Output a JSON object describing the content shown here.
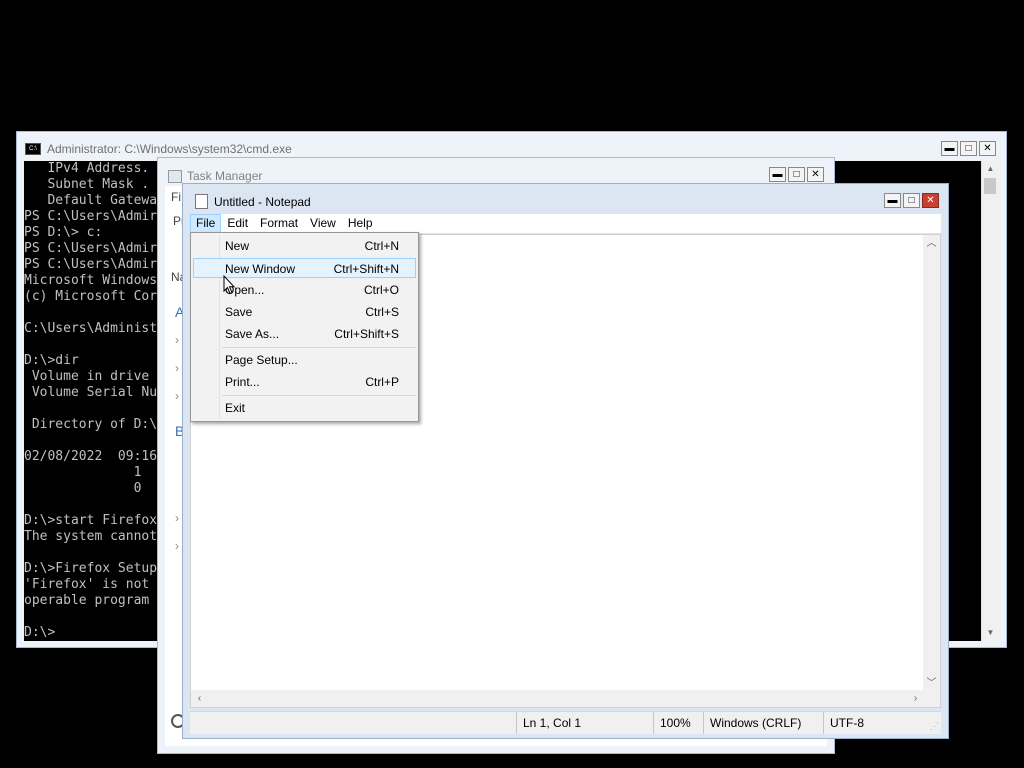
{
  "cmd": {
    "title": "Administrator: C:\\Windows\\system32\\cmd.exe",
    "icon": "cmd-icon",
    "lines": [
      "   IPv4 Address. ",
      "   Subnet Mask . ",
      "   Default Gatewa",
      "PS C:\\Users\\Admir",
      "PS D:\\> c:",
      "PS C:\\Users\\Admir",
      "PS C:\\Users\\Admir",
      "Microsoft Windows",
      "(c) Microsoft Cor",
      "",
      "C:\\Users\\Administ",
      "",
      "D:\\>dir",
      " Volume in drive ",
      " Volume Serial Nu",
      "",
      " Directory of D:\\",
      "",
      "02/08/2022  09:16",
      "              1",
      "              0",
      "",
      "D:\\>start Firefox",
      "The system cannot",
      "",
      "D:\\>Firefox Setup",
      "'Firefox' is not ",
      "operable program ",
      "",
      "D:\\>"
    ]
  },
  "task_manager": {
    "title": "Task Manager",
    "frags": [
      "Fi",
      "Pr",
      "Na",
      "A",
      "B",
      "›",
      "›",
      "›",
      "›",
      "›"
    ]
  },
  "notepad": {
    "title": "Untitled - Notepad",
    "menu": [
      "File",
      "Edit",
      "Format",
      "View",
      "Help"
    ],
    "status": {
      "position": "Ln 1, Col 1",
      "zoom": "100%",
      "line_ending": "Windows (CRLF)",
      "encoding": "UTF-8"
    }
  },
  "file_menu": {
    "items": [
      {
        "label": "New",
        "shortcut": "Ctrl+N"
      },
      {
        "label": "New Window",
        "shortcut": "Ctrl+Shift+N"
      },
      {
        "label": "Open...",
        "shortcut": "Ctrl+O"
      },
      {
        "label": "Save",
        "shortcut": "Ctrl+S"
      },
      {
        "label": "Save As...",
        "shortcut": "Ctrl+Shift+S"
      },
      {
        "label": "Page Setup...",
        "shortcut": ""
      },
      {
        "label": "Print...",
        "shortcut": "Ctrl+P"
      },
      {
        "label": "Exit",
        "shortcut": ""
      }
    ],
    "highlighted": "New Window"
  },
  "window_buttons": {
    "minimize": "▬",
    "maximize": "□",
    "close": "✕"
  }
}
